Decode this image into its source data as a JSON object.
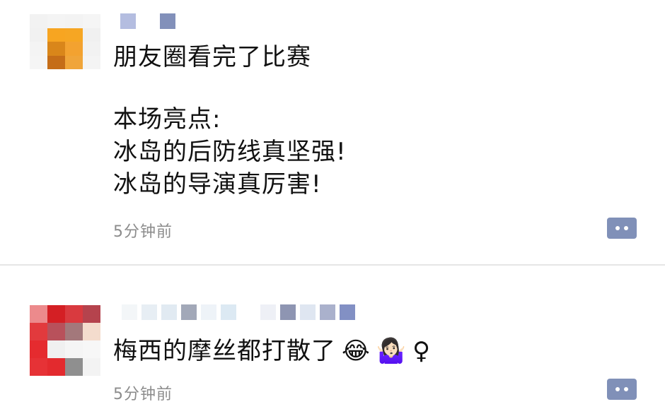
{
  "posts": [
    {
      "content_lines": [
        "朋友圈看完了比赛",
        "",
        "本场亮点:",
        "冰岛的后防线真坚强!",
        "冰岛的导演真厉害!"
      ],
      "timestamp": "5分钟前",
      "avatar_colors": [
        "#f2f2f2",
        "#f4f4f4",
        "#f3f3f3",
        "#f5f5f5",
        "#f1f1f1",
        "#f7a521",
        "#f6a623",
        "#f0f0f0",
        "#f4f4f4",
        "#d9861a",
        "#f3a230",
        "#f2f2f2",
        "#f5f5f5",
        "#c56d18",
        "#f0a53a",
        "#f4f4f4"
      ],
      "name_mosaic_colors": [
        "#b4bde0",
        "#ffffff",
        "#8290ba"
      ],
      "comment_icon": "comment-bubble-icon"
    },
    {
      "content_text": "梅西的摩丝都打散了",
      "emojis": [
        "😂",
        "🤷🏻‍♀️",
        "♀"
      ],
      "timestamp": "5分钟前",
      "avatar_colors": [
        "#ec8a8c",
        "#d41f24",
        "#d93a3f",
        "#b5434d",
        "#e23a3d",
        "#b8515b",
        "#a3787b",
        "#f4dccd",
        "#e52b2f",
        "#f0f0f0",
        "#f5f5f5",
        "#f7f7f7",
        "#e63236",
        "#e32a2e",
        "#8f8f8f",
        "#f3f3f3"
      ],
      "name_mosaic_colors": [
        "#f3f6f8",
        "#e7eef4",
        "#e1eaf2",
        "#a2a8b8",
        "#eef3f8",
        "#dce9f3",
        "#ffffff",
        "#eef0f6",
        "#8e95b2",
        "#dfe6f1",
        "#aab1cc",
        "#8290c4"
      ],
      "comment_icon": "comment-bubble-icon"
    }
  ],
  "colors": {
    "text_primary": "#111111",
    "text_secondary": "#8c8c8c",
    "comment_button": "#8090b8",
    "divider": "#e6e6e6"
  }
}
